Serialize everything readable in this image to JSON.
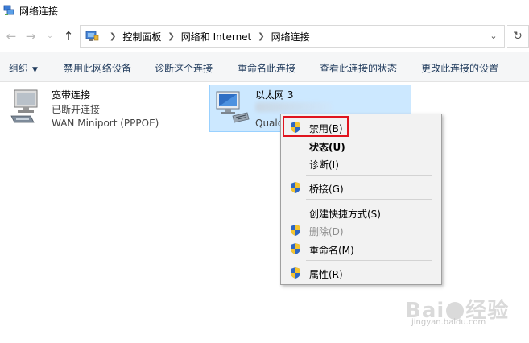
{
  "window": {
    "title": "网络连接"
  },
  "address": {
    "crumbs": [
      "控制面板",
      "网络和 Internet",
      "网络连接"
    ]
  },
  "commands": {
    "organize": "组织",
    "disable_device": "禁用此网络设备",
    "diagnose": "诊断这个连接",
    "rename": "重命名此连接",
    "view_status": "查看此连接的状态",
    "change_settings": "更改此连接的设置"
  },
  "connections": {
    "broadband": {
      "name": "宽带连接",
      "status": "已断开连接",
      "device": "WAN Miniport (PPPOE)"
    },
    "ethernet": {
      "name": "以太网 3",
      "device_partial": "Qualc"
    }
  },
  "context_menu": {
    "items": [
      {
        "label": "禁用(B)",
        "shield": true
      },
      {
        "label": "状态(U)",
        "bold": true
      },
      {
        "label": "诊断(I)"
      },
      {
        "label": "桥接(G)",
        "shield": true
      },
      {
        "label": "创建快捷方式(S)"
      },
      {
        "label": "删除(D)",
        "shield": true,
        "disabled": true
      },
      {
        "label": "重命名(M)",
        "shield": true
      },
      {
        "label": "属性(R)",
        "shield": true
      }
    ]
  },
  "watermark": {
    "brand": "Bai",
    "brand_suffix": "经验",
    "url": "jingyan.baidu.com"
  },
  "colors": {
    "selection_bg": "#cce8ff",
    "highlight_box": "#e0141e",
    "command_text": "#1e395b"
  }
}
